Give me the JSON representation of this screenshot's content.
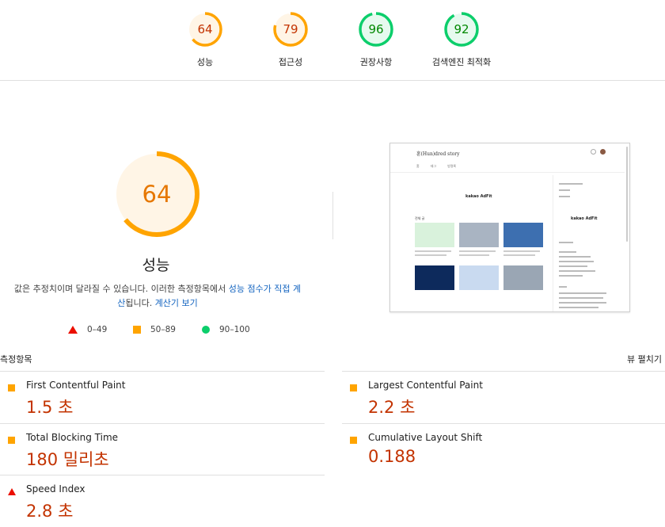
{
  "top_scores": [
    {
      "score": "64",
      "label": "성능",
      "status": "average",
      "color": "#ffa400",
      "fraction": 0.64
    },
    {
      "score": "79",
      "label": "접근성",
      "status": "average",
      "color": "#ffa400",
      "fraction": 0.79
    },
    {
      "score": "96",
      "label": "권장사항",
      "status": "pass",
      "color": "#0cce6b",
      "fraction": 0.96
    },
    {
      "score": "92",
      "label": "검색엔진 최적화",
      "status": "pass",
      "color": "#0cce6b",
      "fraction": 0.92
    }
  ],
  "main": {
    "score": "64",
    "fraction": 0.64,
    "title": "성능",
    "desc_prefix": "값은 추정치이며 달라질 수 있습니다. 이러한 측정항목에서 ",
    "desc_link1": "성능 점수가 직접 계산",
    "desc_middle": "됩니다. ",
    "desc_link2": "계산기 보기",
    "colors": {
      "average": "#ffa400",
      "average_text": "#e67700",
      "fail": "#eb0f00",
      "pass": "#0cce6b",
      "average_bg": "#fff5e6"
    }
  },
  "legend": [
    {
      "icon": "triangle-fail-icon",
      "range": "0–49"
    },
    {
      "icon": "square-average-icon",
      "range": "50–89"
    },
    {
      "icon": "circle-pass-icon",
      "range": "90–100"
    }
  ],
  "screenshot": {
    "site_title": "훈(Hun)dred story",
    "nav": [
      "홈",
      "태그",
      "방명록"
    ],
    "ad_label": "kakao AdFit",
    "section_label": "전체 글"
  },
  "metrics_section": {
    "title": "측정항목",
    "expand_label": "뷰 펼치기"
  },
  "metrics": [
    {
      "name": "First Contentful Paint",
      "value": "1.5 초",
      "status": "average"
    },
    {
      "name": "Largest Contentful Paint",
      "value": "2.2 초",
      "status": "average"
    },
    {
      "name": "Total Blocking Time",
      "value": "180 밀리초",
      "status": "average"
    },
    {
      "name": "Cumulative Layout Shift",
      "value": "0.188",
      "status": "average"
    },
    {
      "name": "Speed Index",
      "value": "2.8 초",
      "status": "fail"
    }
  ]
}
